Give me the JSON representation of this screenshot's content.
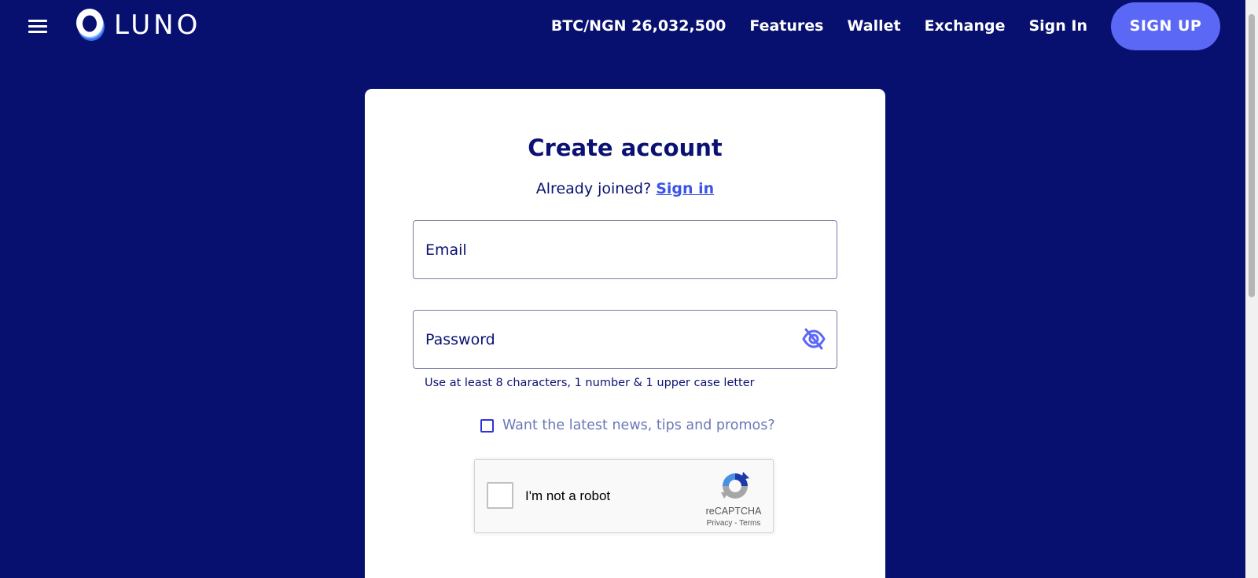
{
  "header": {
    "logo_text": "LUNO",
    "ticker": "BTC/NGN 26,032,500",
    "nav": [
      "Features",
      "Wallet",
      "Exchange",
      "Sign In"
    ],
    "signup_label": "SIGN UP",
    "icons": {
      "menu": "hamburger-menu-icon",
      "logo": "luno-logo-icon"
    }
  },
  "form": {
    "title": "Create account",
    "already_text": "Already joined?",
    "signin_link": "Sign in",
    "email_placeholder": "Email",
    "password_placeholder": "Password",
    "password_hint": "Use at least 8 characters, 1 number & 1 upper case letter",
    "promo_label": "Want the latest news, tips and promos?",
    "password_toggle_icon": "eye-off-icon"
  },
  "recaptcha": {
    "label": "I'm not a robot",
    "brand": "reCAPTCHA",
    "privacy": "Privacy",
    "separator": " - ",
    "terms": "Terms"
  },
  "colors": {
    "background": "#08106f",
    "card": "#ffffff",
    "primary_text": "#0a1172",
    "accent": "#5b68f6",
    "link": "#3b53e8"
  }
}
